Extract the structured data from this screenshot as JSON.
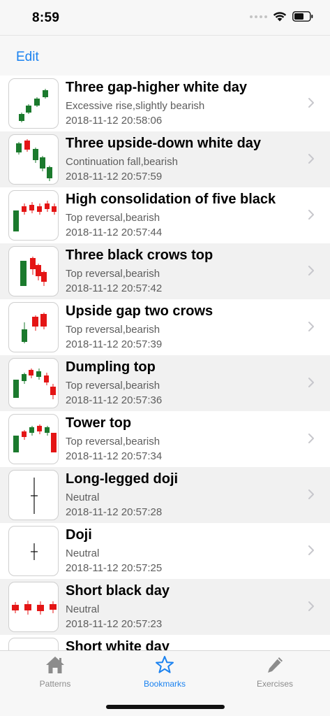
{
  "status_bar": {
    "time": "8:59"
  },
  "nav": {
    "edit_label": "Edit"
  },
  "colors": {
    "accent": "#1a82f0",
    "bull": "#1b7a2d",
    "bear": "#e41515"
  },
  "patterns": [
    {
      "title": "Three gap-higher white day",
      "subtitle": "Excessive rise,slightly bearish",
      "date": "2018-11-12 20:58:06",
      "icon": "three-gap-higher-pattern-icon"
    },
    {
      "title": "Three upside-down white day",
      "subtitle": "Continuation fall,bearish",
      "date": "2018-11-12 20:57:59",
      "icon": "three-upside-down-pattern-icon"
    },
    {
      "title": "High consolidation of five black",
      "subtitle": "Top reversal,bearish",
      "date": "2018-11-12 20:57:44",
      "icon": "five-black-consolidation-pattern-icon"
    },
    {
      "title": "Three black crows top",
      "subtitle": "Top reversal,bearish",
      "date": "2018-11-12 20:57:42",
      "icon": "three-black-crows-pattern-icon"
    },
    {
      "title": "Upside gap two crows",
      "subtitle": "Top reversal,bearish",
      "date": "2018-11-12 20:57:39",
      "icon": "upside-gap-two-crows-pattern-icon"
    },
    {
      "title": "Dumpling top",
      "subtitle": "Top reversal,bearish",
      "date": "2018-11-12 20:57:36",
      "icon": "dumpling-top-pattern-icon"
    },
    {
      "title": "Tower top",
      "subtitle": "Top reversal,bearish",
      "date": "2018-11-12 20:57:34",
      "icon": "tower-top-pattern-icon"
    },
    {
      "title": "Long-legged doji",
      "subtitle": "Neutral",
      "date": "2018-11-12 20:57:28",
      "icon": "long-legged-doji-pattern-icon"
    },
    {
      "title": "Doji",
      "subtitle": "Neutral",
      "date": "2018-11-12 20:57:25",
      "icon": "doji-pattern-icon"
    },
    {
      "title": "Short black day",
      "subtitle": "Neutral",
      "date": "2018-11-12 20:57:23",
      "icon": "short-black-day-pattern-icon"
    },
    {
      "title": "Short white day",
      "subtitle": "",
      "date": "",
      "icon": "short-white-day-pattern-icon"
    }
  ],
  "tabs": [
    {
      "label": "Patterns",
      "icon": "house-icon"
    },
    {
      "label": "Bookmarks",
      "icon": "star-icon"
    },
    {
      "label": "Exercises",
      "icon": "pencil-icon"
    }
  ]
}
